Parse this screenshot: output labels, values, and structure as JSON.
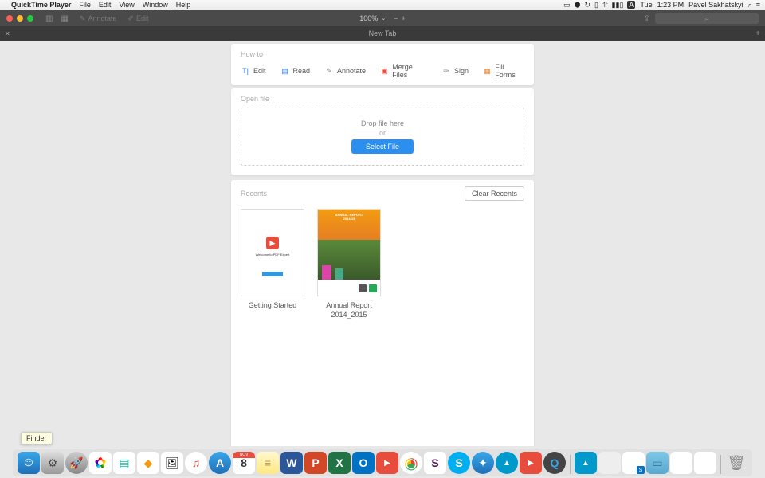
{
  "menubar": {
    "app_name": "QuickTime Player",
    "menus": [
      "File",
      "Edit",
      "View",
      "Window",
      "Help"
    ],
    "time": "1:23 PM",
    "day": "Tue",
    "user": "Pavel Sakhatskyi"
  },
  "chrome": {
    "annotate_label": "Annotate",
    "edit_label": "Edit",
    "zoom": "100%",
    "search_placeholder": "⌕"
  },
  "tab": {
    "title": "New Tab"
  },
  "howto": {
    "label": "How to",
    "items": [
      {
        "label": "Edit"
      },
      {
        "label": "Read"
      },
      {
        "label": "Annotate"
      },
      {
        "label": "Merge Files"
      },
      {
        "label": "Sign"
      },
      {
        "label": "Fill Forms"
      }
    ]
  },
  "openfile": {
    "label": "Open file",
    "drop_text": "Drop file here",
    "or_text": "or",
    "select_btn": "Select File"
  },
  "recents": {
    "label": "Recents",
    "clear_btn": "Clear Recents",
    "items": [
      {
        "name": "Getting Started",
        "thumb_text": "Welcome to PDF Expert"
      },
      {
        "name": "Annual Report 2014_2015",
        "thumb_title": "ANNUAL REPORT\n2014-15"
      }
    ]
  },
  "tooltip": {
    "text": "Finder"
  },
  "dock": {
    "cal_month": "NOV",
    "cal_day": "8"
  }
}
